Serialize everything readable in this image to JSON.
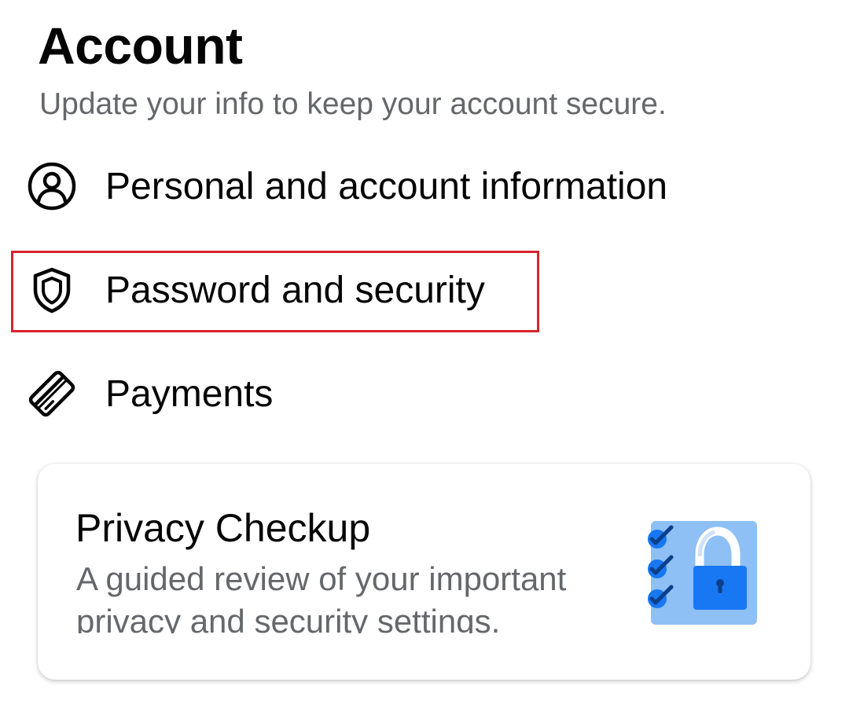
{
  "account": {
    "title": "Account",
    "subtitle": "Update your info to keep your account secure."
  },
  "menu": {
    "items": [
      {
        "label": "Personal and account information",
        "icon": "person-circle-icon"
      },
      {
        "label": "Password and security",
        "icon": "shield-icon",
        "highlighted": true
      },
      {
        "label": "Payments",
        "icon": "credit-card-icon"
      }
    ]
  },
  "privacy_checkup": {
    "title": "Privacy Checkup",
    "description": "A guided review of your important privacy and security settings.",
    "illustration": "checklist-lock-icon"
  },
  "colors": {
    "text_primary": "#050505",
    "text_secondary": "#65676b",
    "highlight_border": "#d9232e",
    "accent_blue": "#1877f2",
    "illustration_bg": "#8ec0f5"
  }
}
